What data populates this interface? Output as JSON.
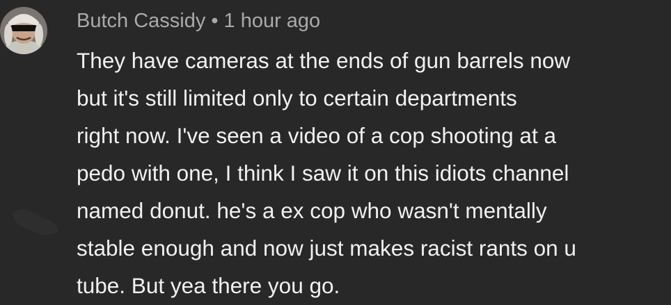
{
  "comment": {
    "author": "Butch Cassidy",
    "separator": "•",
    "timestamp": "1 hour ago",
    "text": "They have cameras at the ends of gun barrels now\nbut it's still limited only to certain departments\nright now. I've seen a video of a cop shooting at a\npedo with one, I think I saw it on this idiots channel\nnamed donut. he's a ex cop who wasn't mentally\nstable enough and now just makes racist rants on u\ntube. But yea there you go.",
    "avatar_icon": "user-avatar-sunglasses"
  },
  "colors": {
    "background": "#282828",
    "meta_text": "#aaaaaa",
    "body_text": "#f1f1f1"
  }
}
